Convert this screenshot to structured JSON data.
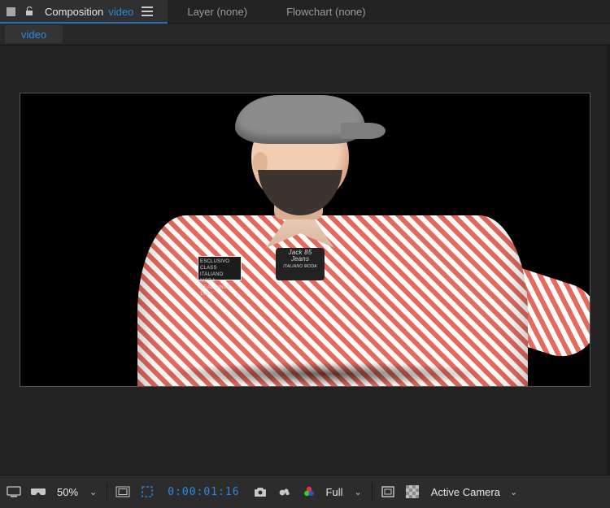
{
  "tabs": {
    "composition": {
      "label": "Composition",
      "link": "video"
    },
    "layer": "Layer (none)",
    "flowchart": "Flowchart (none)"
  },
  "subtab": "video",
  "patches": {
    "p1a": "ESCLUSIVO CLASS",
    "p1b": "ITALIANO MODA",
    "p1c": "REAL SINCE 1984",
    "p2a": "Jack 85",
    "p2b": "Jeans",
    "p2c": "ITALIANO MODA"
  },
  "footer": {
    "zoom": "50%",
    "timecode": "0:00:01:16",
    "resolution": "Full",
    "camera": "Active Camera"
  }
}
